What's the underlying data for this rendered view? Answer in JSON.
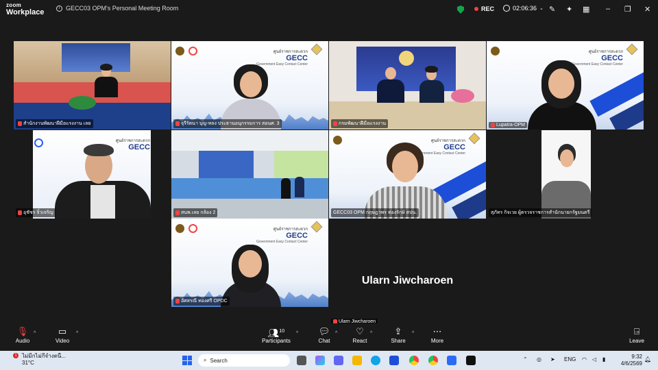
{
  "titlebar": {
    "logo_line1": "zoom",
    "logo_line2": "Workplace",
    "meeting_title": "GECC03 OPM's Personal Meeting Room",
    "rec_label": "REC",
    "timer": "02:06:36"
  },
  "tiles": [
    {
      "name": "สำนักงานพัฒนาฝีมือแรงงาน เลย"
    },
    {
      "name": "จุรีรัตนา บุญ-หลง ประธานอนุกรรมการ สอนศ. 3"
    },
    {
      "name": "กรมพัฒนาฝีมือแรงงาน"
    },
    {
      "name": "Lupatra-OPM"
    },
    {
      "name": "อุชัชร จิ๋วเจริญ"
    },
    {
      "name": "สนพ.เลย กล้อง 2"
    },
    {
      "name": "GECC03 OPM กฤษฎาพร ท่องรักษ์ สปน."
    },
    {
      "name": "สุภัทร กิจเวย ผู้ตรวจราชการสำนักนายกรัฐมนตรี"
    },
    {
      "name": "อัศสรณี ทองศรี OPDC"
    },
    {
      "name": "Ularn Jiwcharoen"
    }
  ],
  "gecc": {
    "brand": "GECC",
    "thai": "ศูนย์ราชการสะดวก",
    "sub": "Government Easy Contact Center"
  },
  "speaker_big_name": "Ularn Jiwcharoen",
  "toolbar": {
    "audio": "Audio",
    "video": "Video",
    "participants": "Participants",
    "participants_count": "10",
    "chat": "Chat",
    "react": "React",
    "share": "Share",
    "more": "More",
    "leave": "Leave"
  },
  "taskbar": {
    "weather_text": "ไม่มีกไม่กีจำงตนื...",
    "weather_temp": "31°C",
    "weather_alert": "1",
    "search_placeholder": "Search",
    "lang": "ENG",
    "time": "9:32",
    "date": "4/6/2569"
  },
  "colors": {
    "active_border": "#22c55e",
    "rec_dot": "#ef4444",
    "mic_muted": "#ef4444",
    "shield": "#16a34a"
  }
}
